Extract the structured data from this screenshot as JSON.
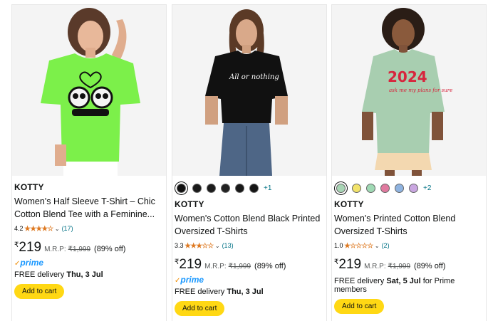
{
  "products": [
    {
      "brand": "KOTTY",
      "title_line1": "Women's Half Sleeve T-Shirt – Chic",
      "title_line2": "Cotton Blend Tee with a Feminine...",
      "rating": "4.2",
      "rating_value": 4.2,
      "review_count": "(17)",
      "currency": "₹",
      "price": "219",
      "mrp_label": "M.R.P:",
      "mrp": "₹1,999",
      "discount": "(89% off)",
      "prime": "prime",
      "delivery_prefix": "FREE delivery",
      "delivery_date": "Thu, 3 Jul",
      "delivery_suffix": "",
      "add_to_cart": "Add to cart",
      "swatches": [],
      "more_colors": ""
    },
    {
      "brand": "KOTTY",
      "title_line1": "Women's Cotton Blend Black Printed",
      "title_line2": "Oversized T-Shirts",
      "rating": "3.3",
      "rating_value": 3.3,
      "review_count": "(13)",
      "currency": "₹",
      "price": "219",
      "mrp_label": "M.R.P:",
      "mrp": "₹1,999",
      "discount": "(89% off)",
      "prime": "prime",
      "delivery_prefix": "FREE delivery",
      "delivery_date": "Thu, 3 Jul",
      "delivery_suffix": "",
      "add_to_cart": "Add to cart",
      "swatches": [
        "#111111",
        "#1a1a1a",
        "#1c1c1c",
        "#222222",
        "#181818",
        "#141414"
      ],
      "more_colors": "+1"
    },
    {
      "brand": "KOTTY",
      "title_line1": "Women's Printed Cotton Blend",
      "title_line2": "Oversized T-Shirts",
      "rating": "1.0",
      "rating_value": 1.0,
      "review_count": "(2)",
      "currency": "₹",
      "price": "219",
      "mrp_label": "M.R.P:",
      "mrp": "₹1,999",
      "discount": "(89% off)",
      "prime": "",
      "delivery_prefix": "FREE delivery",
      "delivery_date": "Sat, 5 Jul",
      "delivery_suffix": "for Prime members",
      "add_to_cart": "Add to cart",
      "swatches": [
        "#a8d5b5",
        "#f2e36b",
        "#9fd9b4",
        "#e07a9f",
        "#8fb3e0",
        "#c9a6e0"
      ],
      "more_colors": "+2"
    }
  ],
  "images": {
    "p1": {
      "shirt_color": "#7cf04a",
      "print": "panda-couple-heart"
    },
    "p2": {
      "shirt_color": "#111111",
      "print_text": "All or nothing"
    },
    "p3": {
      "shirt_color": "#a8ceb0",
      "print_text": "2024"
    }
  },
  "colors": {
    "accent_button": "#ffd814",
    "link": "#007185",
    "star": "#de7921",
    "prime": "#1a98ff"
  }
}
